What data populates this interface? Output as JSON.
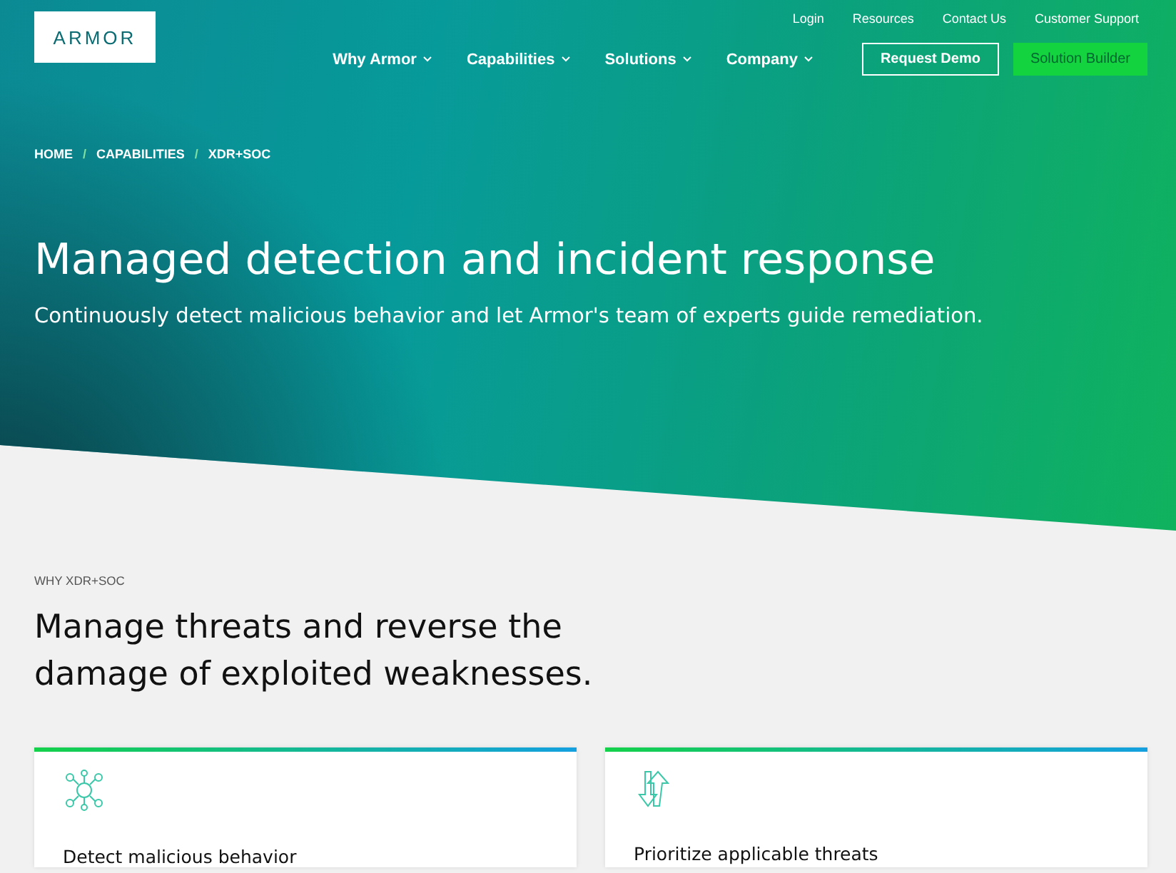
{
  "logo": "ARMOR",
  "utility_links": [
    "Login",
    "Resources",
    "Contact Us",
    "Customer Support"
  ],
  "nav": [
    {
      "label": "Why Armor"
    },
    {
      "label": "Capabilities"
    },
    {
      "label": "Solutions"
    },
    {
      "label": "Company"
    }
  ],
  "buttons": [
    {
      "label": "Request Demo",
      "kind": "outline"
    },
    {
      "label": "Solution Builder",
      "kind": "solid"
    }
  ],
  "breadcrumb": [
    "HOME",
    "CAPABILITIES",
    "XDR+SOC"
  ],
  "breadcrumb_separator": "/",
  "hero": {
    "title": "Managed detection and incident response",
    "subtitle": "Continuously detect malicious behavior and let Armor's team of experts guide remediation."
  },
  "section": {
    "eyebrow": "WHY XDR+SOC",
    "heading": "Manage threats and reverse the damage of exploited weaknesses."
  },
  "cards": [
    {
      "title": "Detect malicious behavior",
      "kind": "network"
    },
    {
      "title": "Prioritize applicable threats",
      "kind": "arrows"
    }
  ]
}
